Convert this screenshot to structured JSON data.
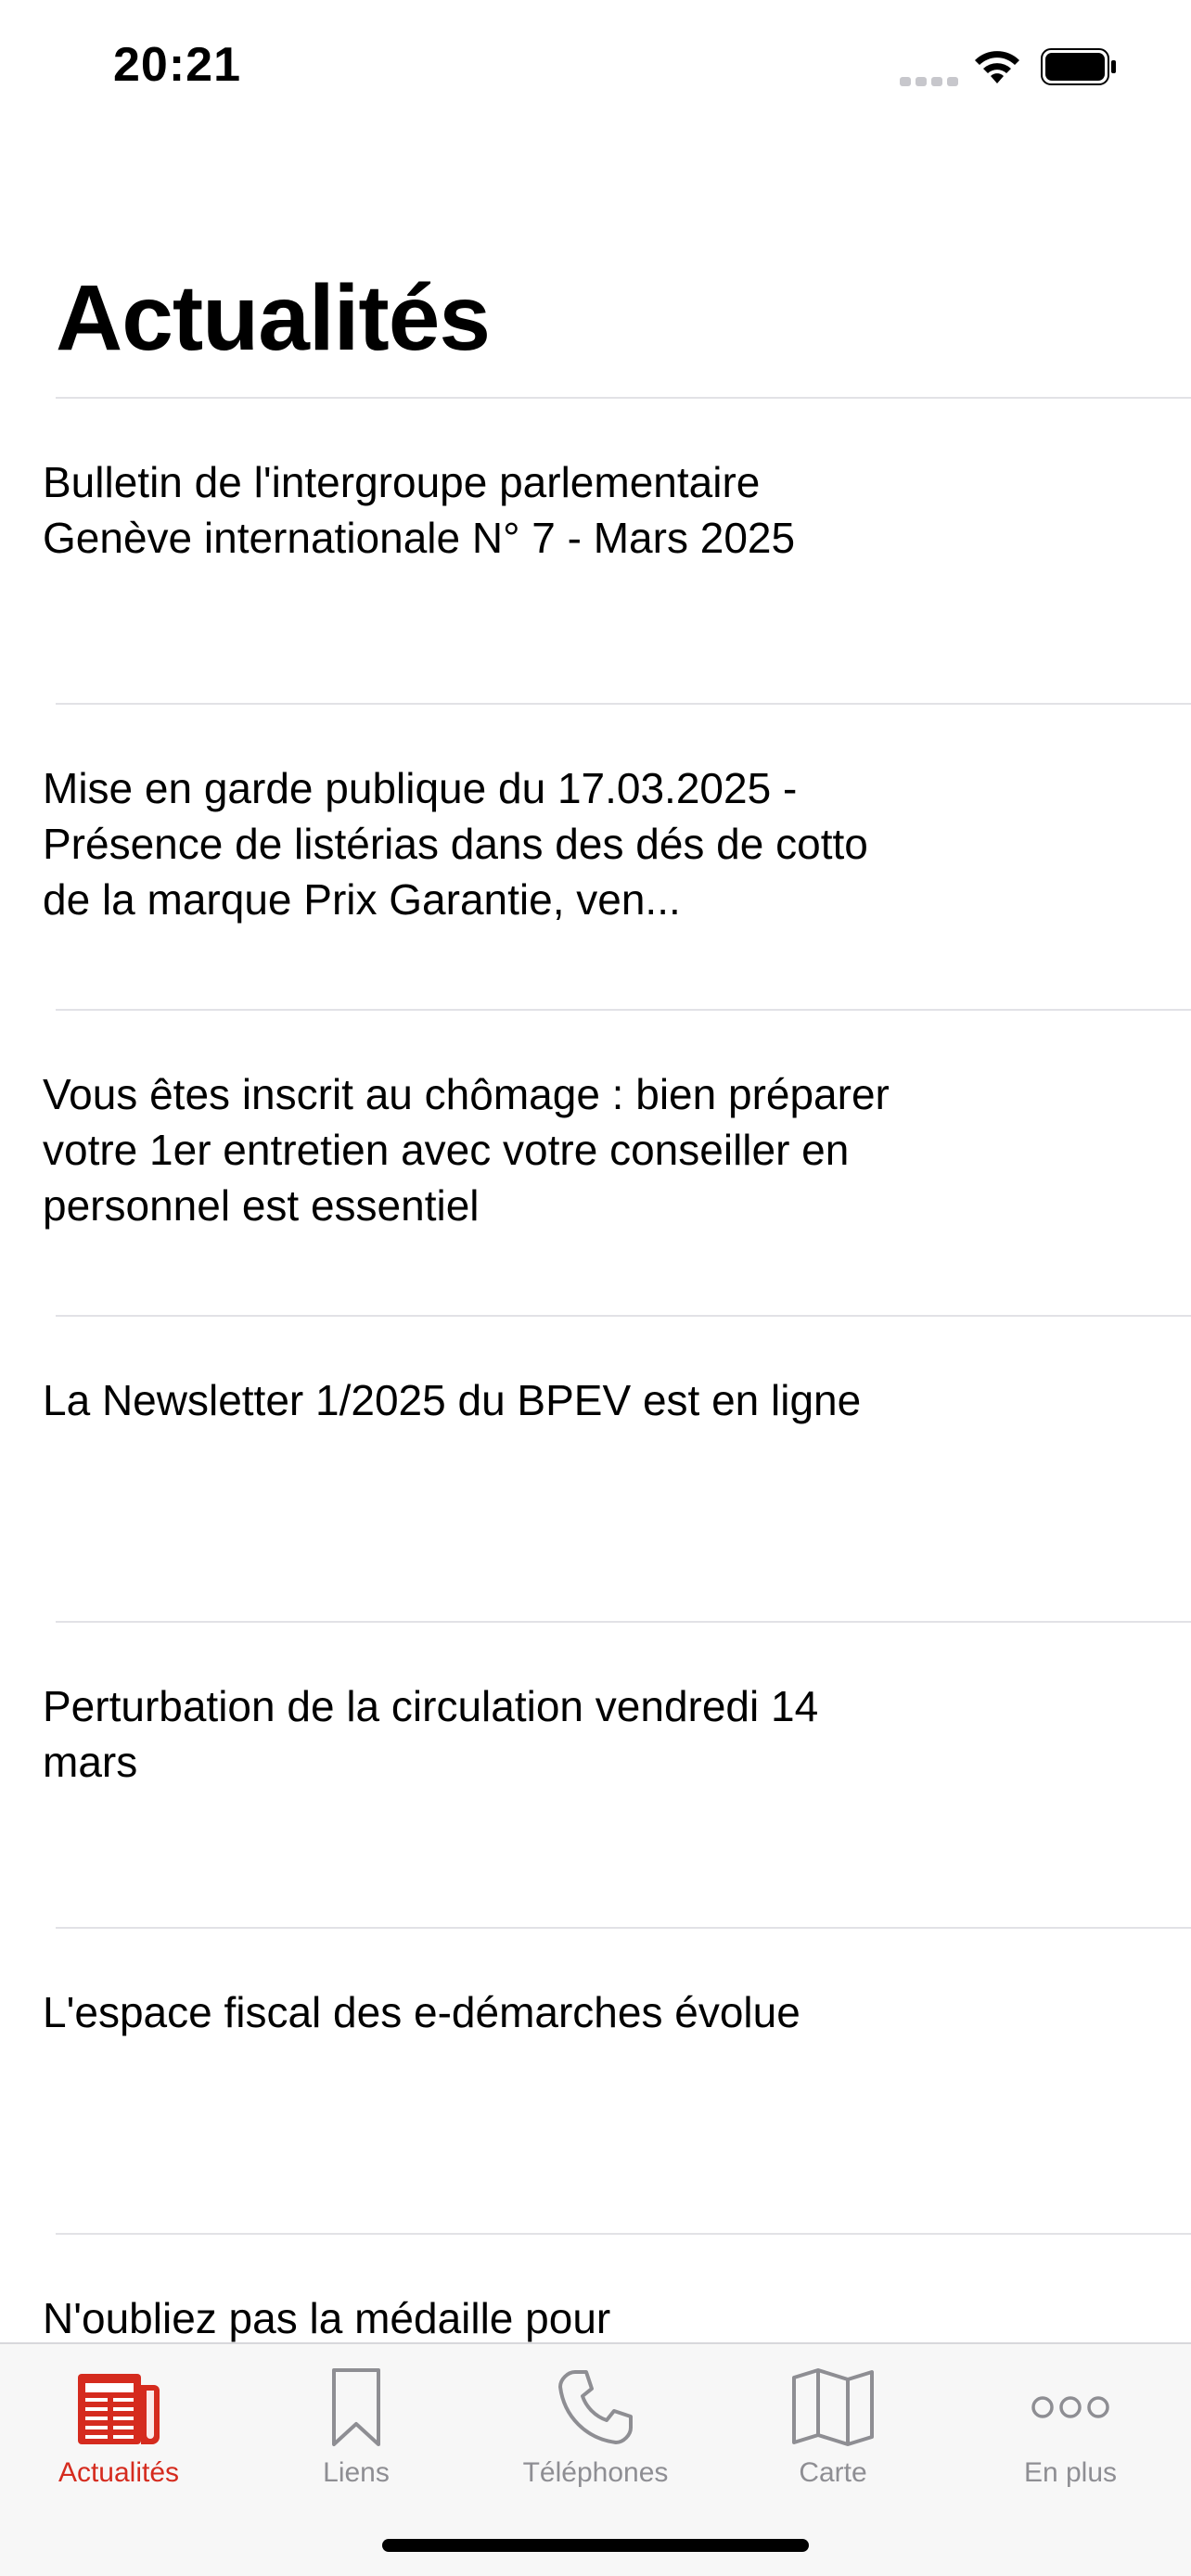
{
  "status_bar": {
    "time": "20:21"
  },
  "title": "Actualités",
  "news": [
    {
      "title": "Bulletin de l'intergroupe parlementaire Genève internationale N° 7 - Mars 2025"
    },
    {
      "title": "Mise en garde publique du 17.03.2025 - Présence de listérias dans des dés de cotto de la marque Prix Garantie, ven..."
    },
    {
      "title": "Vous êtes inscrit au chômage : bien préparer votre 1er entretien avec votre conseiller en personnel est essentiel"
    },
    {
      "title": "La Newsletter 1/2025 du BPEV est en ligne"
    },
    {
      "title": "Perturbation de la circulation vendredi 14 mars"
    },
    {
      "title": "L'espace fiscal des e-démarches évolue"
    },
    {
      "title": "N'oubliez pas la médaille pour"
    }
  ],
  "tabs": [
    {
      "label": "Actualités",
      "icon": "newspaper-icon",
      "active": true
    },
    {
      "label": "Liens",
      "icon": "bookmark-icon",
      "active": false
    },
    {
      "label": "Téléphones",
      "icon": "phone-icon",
      "active": false
    },
    {
      "label": "Carte",
      "icon": "map-icon",
      "active": false
    },
    {
      "label": "En plus",
      "icon": "more-icon",
      "active": false
    }
  ],
  "colors": {
    "accent": "#d52b1e",
    "inactive": "#8e8e93"
  }
}
